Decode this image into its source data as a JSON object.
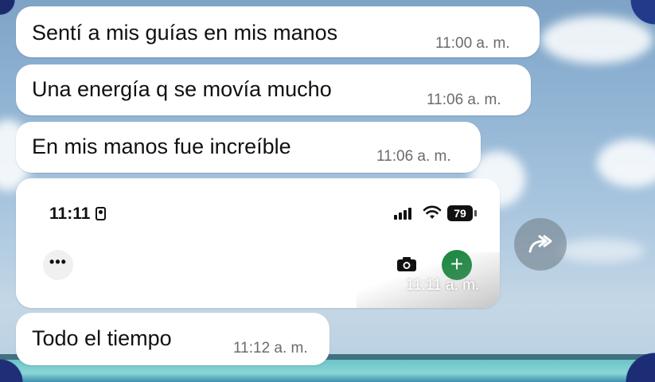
{
  "messages": [
    {
      "text": "Sentí a mis guías en mis manos",
      "time": "11:00 a. m."
    },
    {
      "text": "Una energía q se movía mucho",
      "time": "11:06 a. m."
    },
    {
      "text": "En mis manos fue increíble",
      "time": "11:06 a. m."
    },
    {
      "text": "Todo el tiempo",
      "time": "11:12 a. m."
    }
  ],
  "image_message": {
    "status_time": "11:11",
    "battery": "79",
    "more_label": "•••",
    "plus_label": "+",
    "time": "11:11 a. m."
  },
  "icons": {
    "forward": "forward-arrow-icon",
    "camera": "camera-icon",
    "signal": "cellular-signal-icon",
    "wifi": "wifi-icon",
    "battery": "battery-icon",
    "id_badge": "id-badge-icon"
  },
  "colors": {
    "bubble": "#ffffff",
    "plus_button": "#1f8a44",
    "timestamp": "#6b6b6b"
  }
}
